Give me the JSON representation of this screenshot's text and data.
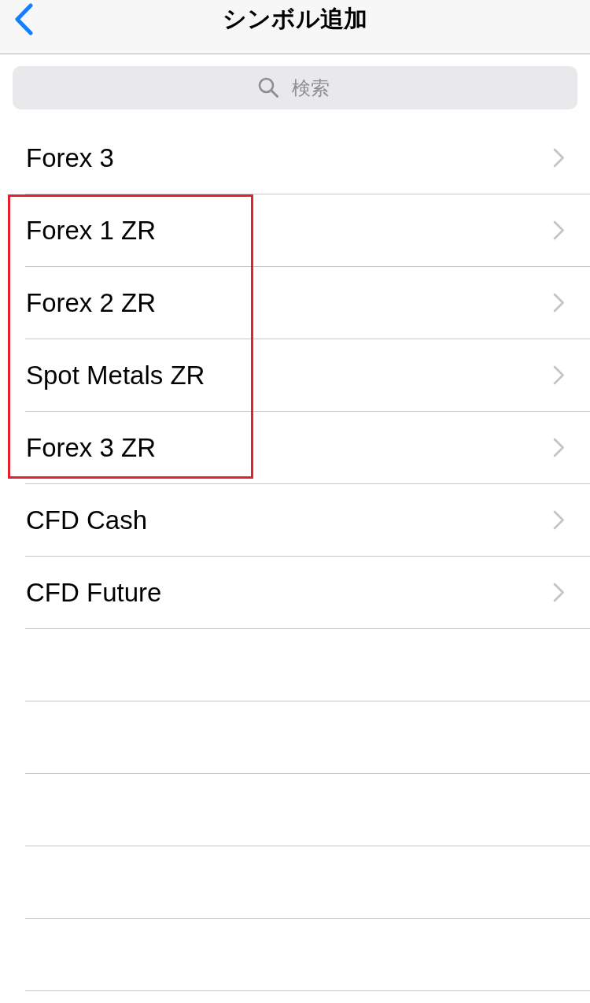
{
  "nav_bar": {
    "title": "シンボル追加"
  },
  "search": {
    "placeholder": "検索"
  },
  "items": [
    {
      "label": "Forex 3",
      "highlighted": false
    },
    {
      "label": "Forex 1 ZR",
      "highlighted": true
    },
    {
      "label": "Forex 2 ZR",
      "highlighted": true
    },
    {
      "label": "Spot Metals ZR",
      "highlighted": true
    },
    {
      "label": "Forex 3 ZR",
      "highlighted": true
    },
    {
      "label": "CFD Cash",
      "highlighted": false
    },
    {
      "label": "CFD Future",
      "highlighted": false
    }
  ]
}
